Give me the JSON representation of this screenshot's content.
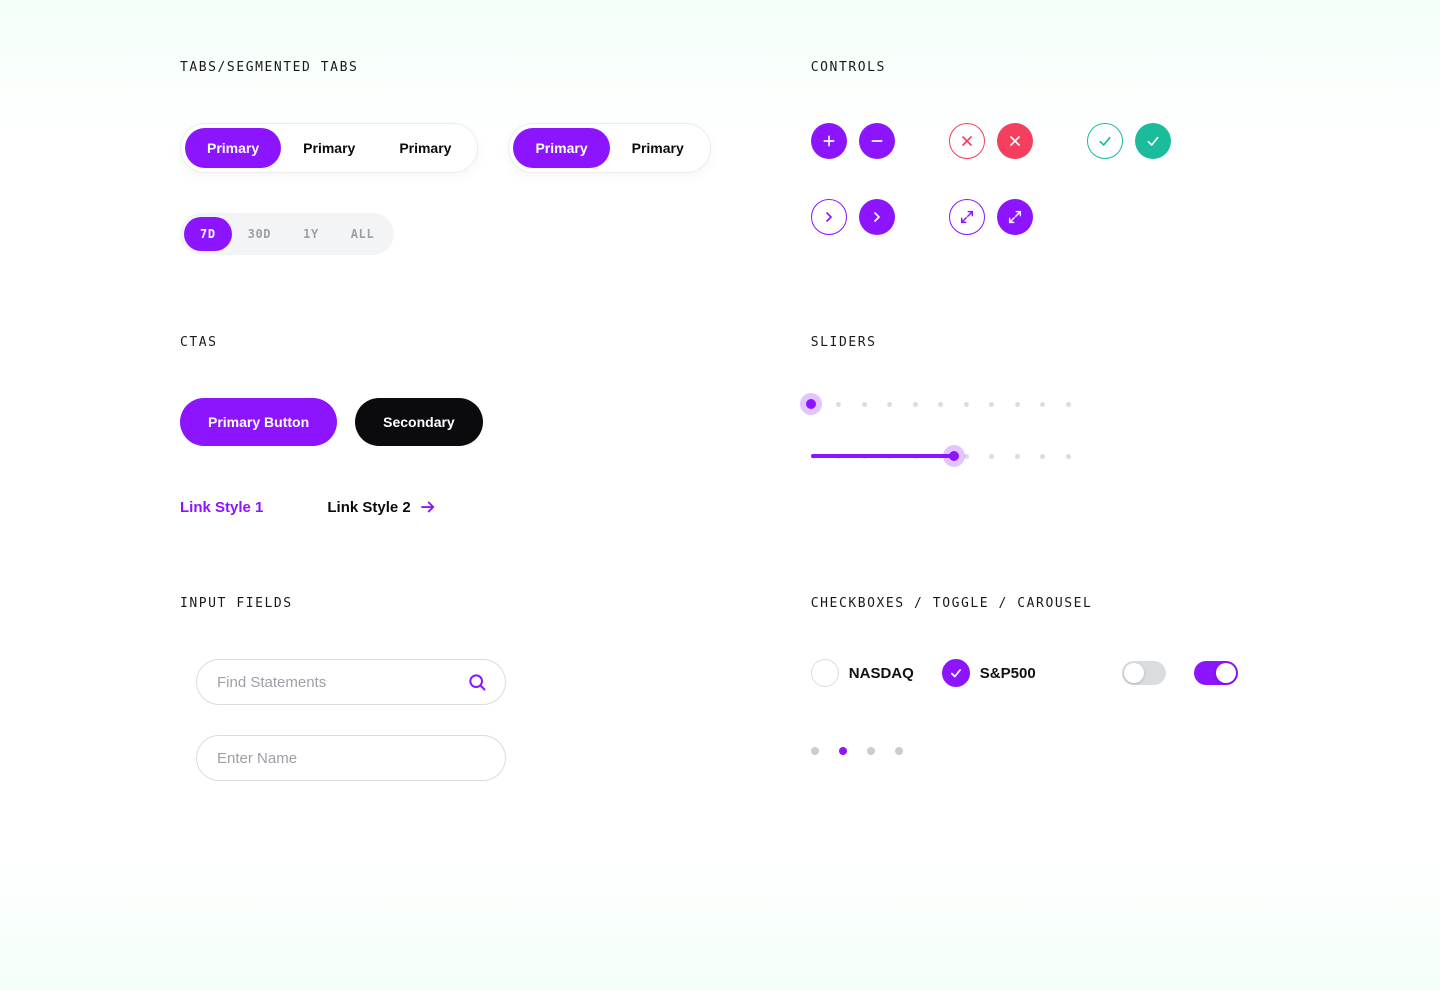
{
  "sections": {
    "tabs": "TABS/SEGMENTED TABS",
    "controls": "CONTROLS",
    "ctas": "CTAS",
    "sliders": "SLIDERS",
    "inputs": "INPUT FIELDS",
    "checks": "CHECKBOXES / TOGGLE / CAROUSEL"
  },
  "tabs": {
    "seg3": [
      "Primary",
      "Primary",
      "Primary"
    ],
    "seg2": [
      "Primary",
      "Primary"
    ],
    "time": [
      "7D",
      "30D",
      "1Y",
      "ALL"
    ],
    "time_active_index": 0,
    "seg3_active_index": 0,
    "seg2_active_index": 0
  },
  "ctas": {
    "primary": "Primary Button",
    "secondary": "Secondary",
    "link1": "Link Style 1",
    "link2": "Link Style 2"
  },
  "inputs": {
    "search_placeholder": "Find Statements",
    "name_placeholder": "Enter Name"
  },
  "sliders": {
    "slider1_value": 0,
    "slider2_value": 55,
    "steps": 11
  },
  "checks": {
    "opt1": {
      "label": "NASDAQ",
      "checked": false
    },
    "opt2": {
      "label": "S&P500",
      "checked": true
    },
    "toggle1": false,
    "toggle2": true,
    "carousel_active_index": 1,
    "carousel_count": 4
  },
  "colors": {
    "purple": "#8C14FF",
    "red": "#F43F5E",
    "teal": "#1ABC9C",
    "black": "#0B0B0E"
  }
}
